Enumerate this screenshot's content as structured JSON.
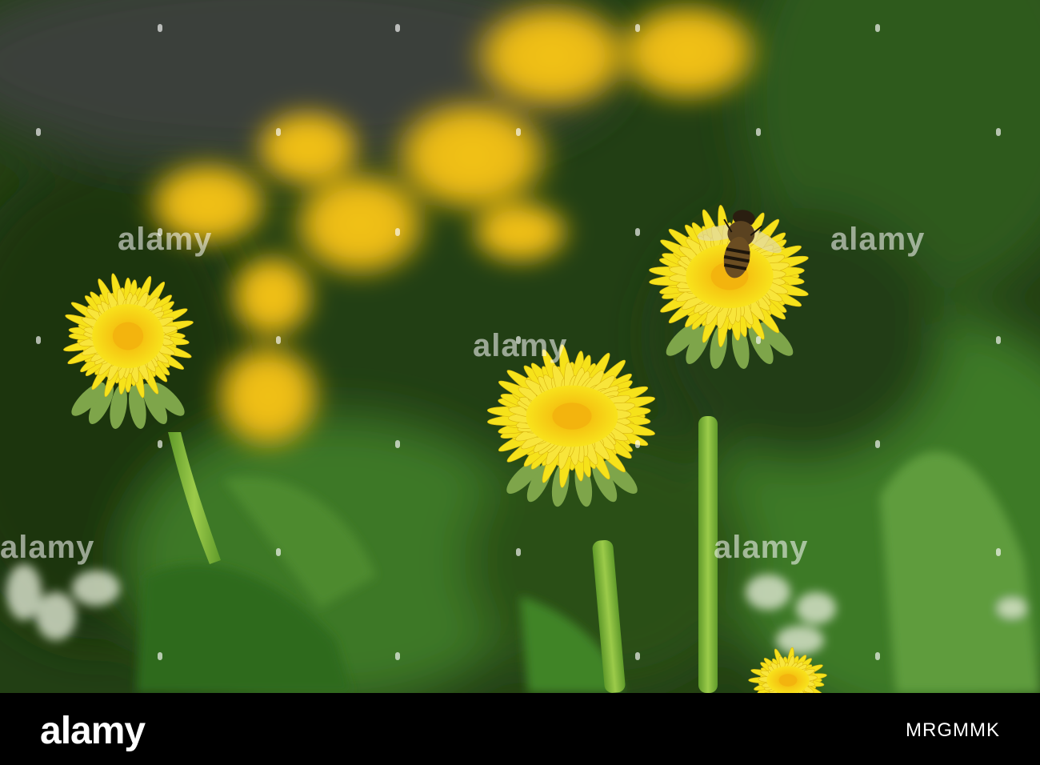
{
  "photo": {
    "subject": "dandelions-with-bee",
    "colors": {
      "background_dark": "#1f3a12",
      "foliage": "#4f8a2a",
      "petal": "#f6e21a",
      "petal_center": "#f3b40e",
      "stem": "#7fb43a",
      "bee": "#3a2a14"
    }
  },
  "watermark": {
    "text": "alamy"
  },
  "footer": {
    "logo": "alamy",
    "image_id": "MRGMMK"
  }
}
